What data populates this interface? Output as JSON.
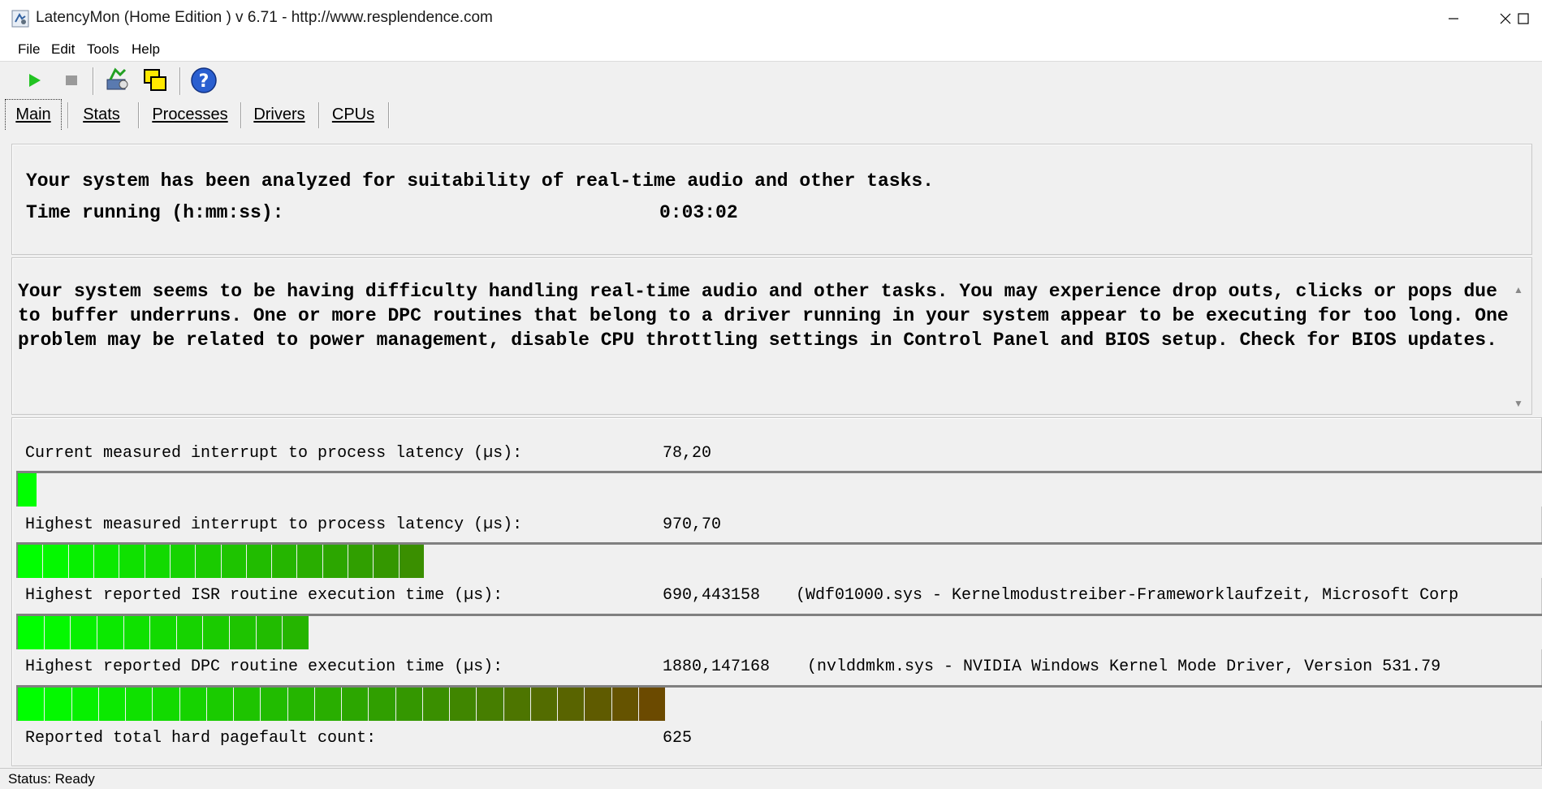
{
  "window": {
    "title": "LatencyMon  (Home Edition )  v 6.71 - http://www.resplendence.com"
  },
  "menu": [
    "File",
    "Edit",
    "Tools",
    "Help"
  ],
  "toolbar": {
    "buttons": [
      "play-icon",
      "stop-icon",
      "analyze-icon",
      "windows-icon",
      "help-icon"
    ]
  },
  "tabs": [
    "Main",
    "Stats",
    "Processes",
    "Drivers",
    "CPUs"
  ],
  "summary": {
    "line1": "Your system has been analyzed for suitability of real-time audio and other tasks.",
    "time_label": "Time running (h:mm:ss):",
    "time_value": "0:03:02"
  },
  "advice": "Your system seems to be having difficulty handling real-time audio and other tasks. You may experience drop outs, clicks or pops due to buffer underruns. One or more DPC routines that belong to a driver running in your system appear to be executing for too long. One problem may be related to power management, disable CPU throttling settings in Control Panel and BIOS setup. Check for BIOS updates.",
  "metrics": [
    {
      "label": "Current measured interrupt to process latency (µs):",
      "value": "78,20",
      "extra": "",
      "bar_fraction": 0.013,
      "segments": 1
    },
    {
      "label": "Highest measured interrupt to process latency (µs):",
      "value": "970,70",
      "extra": "",
      "bar_fraction": 0.267,
      "segments": 16
    },
    {
      "label": "Highest reported ISR routine execution time (µs):",
      "value": "690,443158",
      "extra": "(Wdf01000.sys - Kernelmodustreiber-Frameworklaufzeit, Microsoft Corp",
      "bar_fraction": 0.191,
      "segments": 11
    },
    {
      "label": "Highest reported DPC routine execution time (µs):",
      "value": "1880,147168",
      "extra": "(nvlddmkm.sys - NVIDIA Windows Kernel Mode Driver, Version 531.79",
      "bar_fraction": 0.425,
      "segments": 24
    },
    {
      "label": "Reported total hard pagefault count:",
      "value": "625",
      "extra": ""
    }
  ],
  "status": "Status: Ready",
  "colors": {
    "bar_start": "#00ff00",
    "bar_mid": "#339900",
    "bar_end": "#6b4a00"
  }
}
